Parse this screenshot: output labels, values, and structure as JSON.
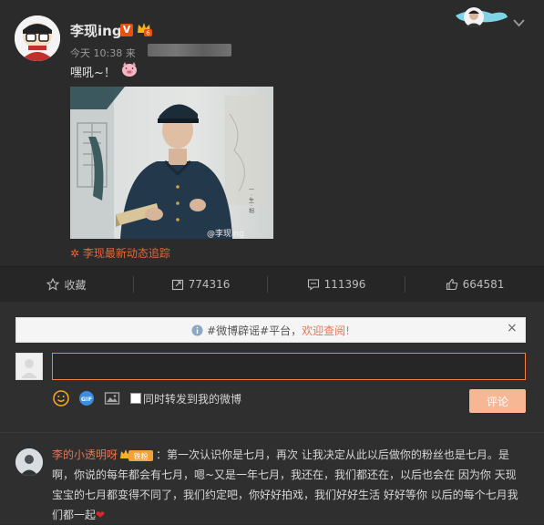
{
  "post": {
    "author": "李现ing",
    "meta_time": "今天 10:38 来",
    "content": "嘿吼~！",
    "watermark": "@李现ing",
    "topic": "李现最新动态追踪"
  },
  "actions": {
    "favorite": "收藏",
    "reposts": "774316",
    "comments": "111396",
    "likes": "664581"
  },
  "notice": {
    "prefix": "#微博辟谣#平台，",
    "link": "欢迎查阅!",
    "close": "×"
  },
  "composer": {
    "input_value": "",
    "sync_label": "同时转发到我的微博",
    "submit_label": "评论"
  },
  "comment": {
    "user": "李的小透明呀",
    "badge": "铁粉",
    "text": "：第一次认识你是七月，再次 让我决定从此以后做你的粉丝也是七月。是啊，你说的每年都会有七月，嗯~又是一年七月，我还在，我们都还在，以后也会在  因为你  天现宝宝的七月都变得不同了，我们约定吧，你好好拍戏，我们好好生活  好好等你  以后的每个七月我们都一起",
    "heart": "❤"
  },
  "colors": {
    "accent": "#eb7350",
    "background": "#2b2b2b",
    "button": "#f7b794"
  }
}
